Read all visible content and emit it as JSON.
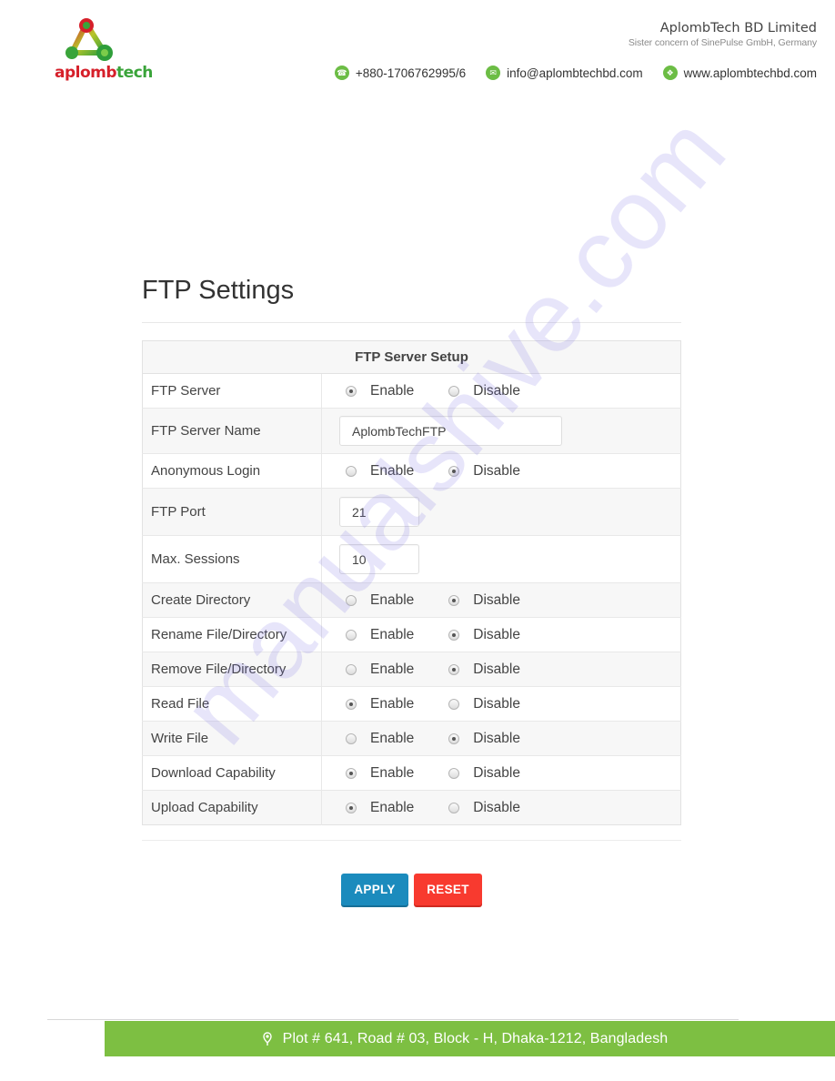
{
  "header": {
    "logo": {
      "text_part1": "aplomb",
      "text_part2": "tech",
      "colors": {
        "red": "#d6202a",
        "green": "#3aa43a"
      }
    },
    "company_name": "AplombTech BD Limited",
    "company_subtitle": "Sister concern of SinePulse GmbH, Germany",
    "contacts": [
      {
        "icon": "phone-icon",
        "text": "+880-1706762995/6"
      },
      {
        "icon": "email-icon",
        "text": "info@aplombtechbd.com"
      },
      {
        "icon": "web-icon",
        "text": "www.aplombtechbd.com"
      }
    ],
    "accent_color": "#6cbd45"
  },
  "page": {
    "title": "FTP Settings",
    "table_header": "FTP Server Setup",
    "rows": [
      {
        "label": "FTP Server",
        "type": "radio",
        "options": [
          "Enable",
          "Disable"
        ],
        "selected": "Enable"
      },
      {
        "label": "FTP Server Name",
        "type": "text",
        "value": "AplombTechFTP"
      },
      {
        "label": "Anonymous Login",
        "type": "radio",
        "options": [
          "Enable",
          "Disable"
        ],
        "selected": "Disable"
      },
      {
        "label": "FTP Port",
        "type": "number",
        "value": "21"
      },
      {
        "label": "Max. Sessions",
        "type": "number",
        "value": "10"
      },
      {
        "label": "Create Directory",
        "type": "radio",
        "options": [
          "Enable",
          "Disable"
        ],
        "selected": "Disable"
      },
      {
        "label": "Rename File/Directory",
        "type": "radio",
        "options": [
          "Enable",
          "Disable"
        ],
        "selected": "Disable"
      },
      {
        "label": "Remove File/Directory",
        "type": "radio",
        "options": [
          "Enable",
          "Disable"
        ],
        "selected": "Disable"
      },
      {
        "label": "Read File",
        "type": "radio",
        "options": [
          "Enable",
          "Disable"
        ],
        "selected": "Enable"
      },
      {
        "label": "Write File",
        "type": "radio",
        "options": [
          "Enable",
          "Disable"
        ],
        "selected": "Disable"
      },
      {
        "label": "Download Capability",
        "type": "radio",
        "options": [
          "Enable",
          "Disable"
        ],
        "selected": "Enable"
      },
      {
        "label": "Upload Capability",
        "type": "radio",
        "options": [
          "Enable",
          "Disable"
        ],
        "selected": "Enable"
      }
    ],
    "buttons": {
      "apply": {
        "label": "APPLY",
        "color": "#1b8bbd"
      },
      "reset": {
        "label": "RESET",
        "color": "#f83a2f"
      }
    }
  },
  "footer": {
    "icon": "location-pin-icon",
    "address": "Plot # 641, Road # 03, Block - H, Dhaka-1212, Bangladesh",
    "bar_color": "#7dbf42"
  },
  "watermark": "manualshive.com"
}
